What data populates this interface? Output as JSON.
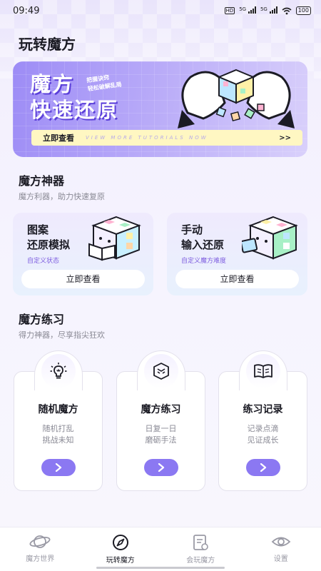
{
  "status": {
    "time": "09:49",
    "network": "HD",
    "signal1": "5G",
    "signal2": "5G",
    "battery": "100"
  },
  "page": {
    "title": "玩转魔方"
  },
  "banner": {
    "title_line1": "魔方",
    "title_line2": "快速还原",
    "sub_line1": "把握诀窍",
    "sub_line2": "轻松破解乱局",
    "cta": "立即查看",
    "cta_en": "VIEW MORE TUTORIALS NOW",
    "cta_arrow": ">>"
  },
  "tools": {
    "title": "魔方神器",
    "subtitle": "魔方利器，助力快速复原",
    "cards": [
      {
        "line1": "图案",
        "line2": "还原模拟",
        "tag": "自定义状态",
        "button": "立即查看"
      },
      {
        "line1": "手动",
        "line2": "输入还原",
        "tag": "自定义魔方难度",
        "button": "立即查看"
      }
    ]
  },
  "practice": {
    "title": "魔方练习",
    "subtitle": "得力神器，尽享指尖狂欢",
    "cards": [
      {
        "title": "随机魔方",
        "desc1": "随机打乱",
        "desc2": "挑战未知",
        "icon": "lightbulb-icon"
      },
      {
        "title": "魔方练习",
        "desc1": "日复一日",
        "desc2": "磨砺手法",
        "icon": "cube-icon"
      },
      {
        "title": "练习记录",
        "desc1": "记录点滴",
        "desc2": "见证成长",
        "icon": "book-icon"
      }
    ]
  },
  "tabbar": {
    "items": [
      {
        "label": "魔方世界",
        "icon": "planet-icon",
        "active": false
      },
      {
        "label": "玩转魔方",
        "icon": "compass-icon",
        "active": true
      },
      {
        "label": "会玩魔方",
        "icon": "document-icon",
        "active": false
      },
      {
        "label": "设置",
        "icon": "eye-icon",
        "active": false
      }
    ]
  },
  "colors": {
    "accent": "#8b78f2",
    "banner": "#9d8cf6",
    "tag": "#7f5fe0",
    "cta_bar": "#fff7c2"
  }
}
